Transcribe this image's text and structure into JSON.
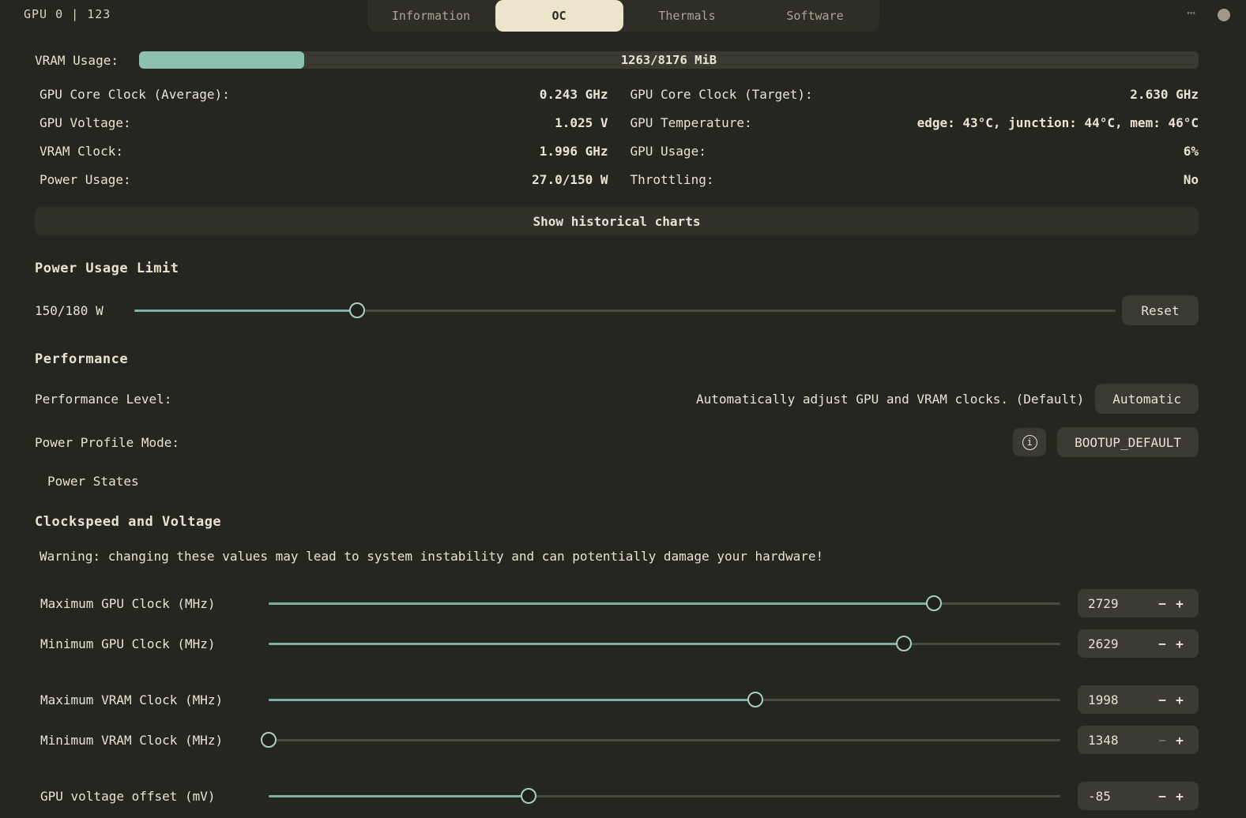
{
  "header": {
    "gpu_label": "GPU 0 | 123",
    "tabs": [
      {
        "label": "Information"
      },
      {
        "label": "OC"
      },
      {
        "label": "Thermals"
      },
      {
        "label": "Software"
      }
    ],
    "icons": {
      "menu": "⋯"
    }
  },
  "stats": {
    "vram": {
      "label": "VRAM Usage:",
      "value_text": "1263/8176 MiB",
      "used_mib": 1263,
      "total_mib": 8176,
      "percent": 15.6
    },
    "rows": [
      {
        "left_label": "GPU Core Clock (Average):",
        "left_value": "0.243 GHz",
        "right_label": "GPU Core Clock (Target):",
        "right_value": "2.630 GHz"
      },
      {
        "left_label": "GPU Voltage:",
        "left_value": "1.025 V",
        "right_label": "GPU Temperature:",
        "right_value": "edge: 43°C, junction: 44°C, mem: 46°C"
      },
      {
        "left_label": "VRAM Clock:",
        "left_value": "1.996 GHz",
        "right_label": "GPU Usage:",
        "right_value": "6%"
      },
      {
        "left_label": "Power Usage:",
        "left_value": "27.0/150 W",
        "right_label": "Throttling:",
        "right_value": "No"
      }
    ],
    "show_charts_label": "Show historical charts"
  },
  "power_limit": {
    "heading": "Power Usage Limit",
    "value_label": "150/180 W",
    "slider_percent": 22.7,
    "reset_label": "Reset"
  },
  "performance": {
    "heading": "Performance",
    "level_label": "Performance Level:",
    "level_description": "Automatically adjust GPU and VRAM clocks. (Default)",
    "level_value": "Automatic",
    "profile_label": "Power Profile Mode:",
    "profile_value": "BOOTUP_DEFAULT",
    "power_states_label": "Power States"
  },
  "clocks": {
    "heading": "Clockspeed and Voltage",
    "warning": "Warning: changing these values may lead to system instability and can potentially damage your hardware!",
    "minus_label": "−",
    "plus_label": "+",
    "sliders": [
      {
        "label": "Maximum GPU Clock (MHz)",
        "value": "2729",
        "percent": 84.0,
        "minus_disabled": false
      },
      {
        "label": "Minimum GPU Clock (MHz)",
        "value": "2629",
        "percent": 80.2,
        "minus_disabled": false
      },
      {
        "label": "Maximum VRAM Clock (MHz)",
        "value": "1998",
        "percent": 61.5,
        "minus_disabled": false
      },
      {
        "label": "Minimum VRAM Clock (MHz)",
        "value": "1348",
        "percent": 0,
        "minus_disabled": true
      },
      {
        "label": "GPU voltage offset (mV)",
        "value": "-85",
        "percent": 32.8,
        "minus_disabled": false
      }
    ]
  }
}
